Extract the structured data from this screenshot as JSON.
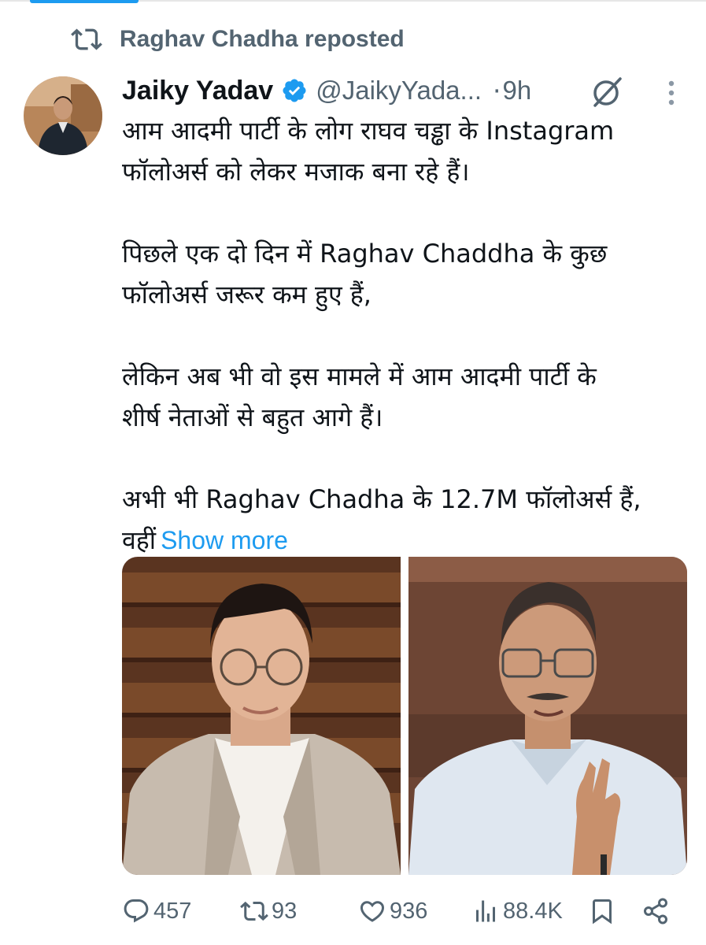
{
  "repost": {
    "label": "Raghav Chadha reposted",
    "icon": "repost-icon"
  },
  "author": {
    "name": "Jaiky Yadav",
    "handle": "@JaikyYada...",
    "separator": "·",
    "time": "9h"
  },
  "tweet": {
    "paragraphs": [
      [
        "आम आदमी पार्टी के लोग राघव चड्ढा के Instagram",
        "फॉलोअर्स को लेकर मजाक बना रहे हैं।"
      ],
      [
        "पिछले एक दो दिन में Raghav Chaddha के कुछ",
        "फॉलोअर्स जरूर कम हुए हैं,"
      ],
      [
        "लेकिन अब भी वो इस मामले में आम आदमी पार्टी के",
        "शीर्ष नेताओं से बहुत आगे हैं।"
      ],
      [
        "अभी भी Raghav Chadha के 12.7M फॉलोअर्स हैं,",
        "वहीं"
      ]
    ],
    "show_more": "Show more"
  },
  "actions": {
    "replies": "457",
    "reposts": "93",
    "likes": "936",
    "views": "88.4K"
  },
  "colors": {
    "accent": "#1d9bf0",
    "secondary_text": "#536471",
    "primary_text": "#0f1419"
  }
}
